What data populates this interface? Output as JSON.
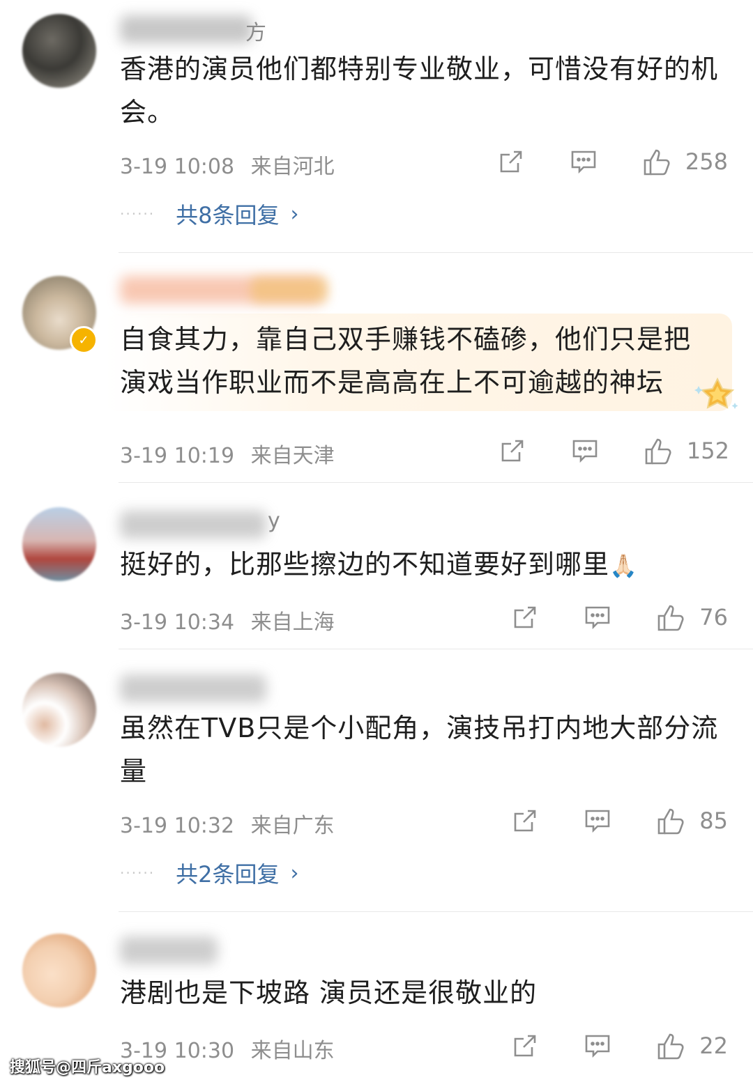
{
  "comments": [
    {
      "text": "香港的演员他们都特别专业敬业，可惜没有好的机会。",
      "name_tail": "方",
      "time": "3-19 10:08",
      "location": "来自河北",
      "likes": "258",
      "replies": "共8条回复",
      "verified": false,
      "highlighted": false
    },
    {
      "text": "自食其力，靠自己双手赚钱不磕碜，他们只是把演戏当作职业而不是高高在上不可逾越的神坛",
      "name_tail": "",
      "time": "3-19 10:19",
      "location": "来自天津",
      "likes": "152",
      "replies": "",
      "verified": true,
      "highlighted": true
    },
    {
      "text": "挺好的，比那些擦边的不知道要好到哪里",
      "emoji": "🙏🏻",
      "name_tail": "y",
      "time": "3-19 10:34",
      "location": "来自上海",
      "likes": "76",
      "replies": "",
      "verified": false,
      "highlighted": false
    },
    {
      "text": "虽然在TVB只是个小配角，演技吊打内地大部分流量",
      "name_tail": "",
      "time": "3-19 10:32",
      "location": "来自广东",
      "likes": "85",
      "replies": "共2条回复",
      "verified": false,
      "highlighted": false
    },
    {
      "text": "港剧也是下坡路 演员还是很敬业的",
      "name_tail": "",
      "time": "3-19 10:30",
      "location": "来自山东",
      "likes": "22",
      "replies": "",
      "verified": false,
      "highlighted": false
    }
  ],
  "watermark": "搜狐号@四斤axgooo",
  "icons": {
    "share": "share-icon",
    "comment": "comment-icon",
    "like": "thumbs-up-icon",
    "chevron": "chevron-right-icon"
  },
  "colors": {
    "link": "#3f6fa5",
    "meta": "#8e8e8e",
    "badge": "#f6b300"
  }
}
